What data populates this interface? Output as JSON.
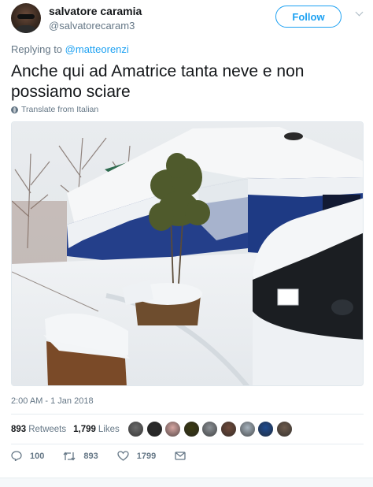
{
  "user": {
    "name": "salvatore caramia",
    "handle": "@salvatorecaram3"
  },
  "follow_label": "Follow",
  "replying": {
    "prefix": "Replying to",
    "mention": "@matteorenzi"
  },
  "tweet_text": "Anche qui ad Amatrice tanta neve e non possiamo sciare",
  "translate_label": "Translate from Italian",
  "timestamp": "2:00 AM - 1 Jan 2018",
  "stats": {
    "retweets_count": "893",
    "retweets_label": "Retweets",
    "likes_count": "1,799",
    "likes_label": "Likes"
  },
  "likers": [
    {
      "color": "#6b6b6b"
    },
    {
      "color": "#2b2b2b"
    },
    {
      "color": "#d7a7a3"
    },
    {
      "color": "#3b3a12"
    },
    {
      "color": "#8c9196"
    },
    {
      "color": "#6e4a3a"
    },
    {
      "color": "#a7b3bd"
    },
    {
      "color": "#1f4b8f"
    },
    {
      "color": "#6d5b4d"
    }
  ],
  "actions": {
    "replies": "100",
    "retweets": "893",
    "likes": "1799"
  },
  "colors": {
    "accent": "#1da1f2",
    "secondary_text": "#657786",
    "primary_text": "#14171a"
  },
  "icons": {
    "reply": "reply-icon",
    "retweet": "retweet-icon",
    "like": "heart-icon",
    "message": "envelope-icon",
    "translate": "globe-icon",
    "menu": "chevron-down-icon"
  }
}
